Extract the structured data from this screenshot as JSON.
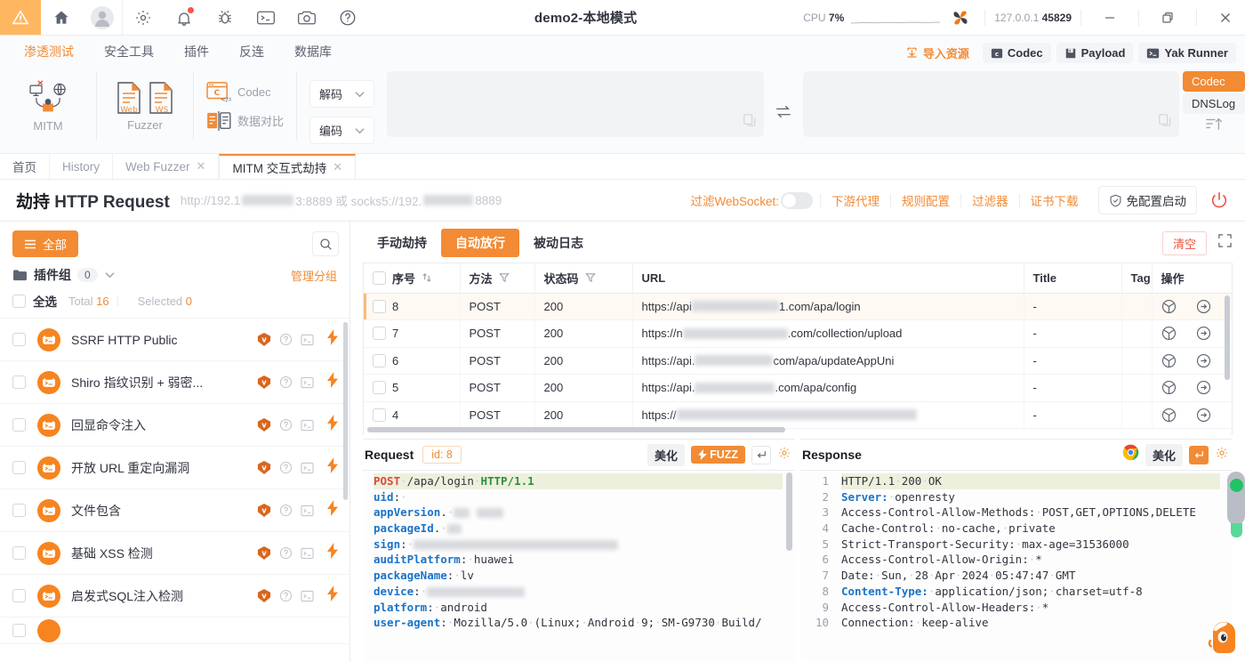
{
  "titlebar": {
    "icons": [
      {
        "name": "warning-triangle-icon",
        "label": "warning"
      },
      {
        "name": "home-icon",
        "label": "home"
      },
      {
        "name": "user-avatar-icon",
        "label": "account"
      },
      {
        "name": "gear-icon",
        "label": "settings"
      },
      {
        "name": "bell-icon",
        "label": "notifications"
      },
      {
        "name": "bug-icon",
        "label": "bug"
      },
      {
        "name": "terminal-icon",
        "label": "terminal"
      },
      {
        "name": "camera-icon",
        "label": "screenshot"
      },
      {
        "name": "help-circle-icon",
        "label": "help"
      }
    ],
    "title": "demo2-本地模式",
    "cpu_label": "CPU",
    "cpu_value": "7%",
    "address_host": "127.0.0.1",
    "address_port": "45829",
    "minimize": "—",
    "maximize": "❐",
    "close": "✕"
  },
  "ribbon": {
    "tabs": [
      {
        "label": "渗透测试",
        "active": true
      },
      {
        "label": "安全工具",
        "active": false
      },
      {
        "label": "插件",
        "active": false
      },
      {
        "label": "反连",
        "active": false
      },
      {
        "label": "数据库",
        "active": false
      }
    ],
    "right_actions": [
      {
        "label": "导入资源",
        "icon": "import-icon",
        "style": "import"
      },
      {
        "label": "Codec",
        "icon": "codec-icon",
        "style": "plain"
      },
      {
        "label": "Payload",
        "icon": "payload-icon",
        "style": "plain"
      },
      {
        "label": "Yak Runner",
        "icon": "yak-runner-icon",
        "style": "plain"
      }
    ],
    "big_buttons": [
      {
        "label": "MITM",
        "icon": "mitm-icon"
      },
      {
        "label": "Fuzzer",
        "icon": "fuzzer-icon"
      }
    ],
    "small_buttons": [
      {
        "label": "Codec",
        "icon": "codec-small-icon"
      },
      {
        "label": "数据对比",
        "icon": "data-compare-icon"
      }
    ],
    "selects": [
      {
        "label": "解码"
      },
      {
        "label": "编码"
      }
    ],
    "codec_stack": [
      {
        "label": "Codec",
        "selected": true
      },
      {
        "label": "DNSLog",
        "selected": false
      }
    ],
    "input_left_value": "",
    "input_right_value": ""
  },
  "page_tabs": [
    {
      "label": "首页",
      "closable": false,
      "active": false
    },
    {
      "label": "History",
      "closable": false,
      "active": false
    },
    {
      "label": "Web Fuzzer",
      "closable": true,
      "active": false
    },
    {
      "label": "MITM 交互式劫持",
      "closable": true,
      "active": true
    }
  ],
  "page_header": {
    "title_cn": "劫持",
    "title_en": "HTTP Request",
    "subtitle_prefix": "http://192.1",
    "subtitle_mid": "3:8889 或 socks5://192.",
    "subtitle_suffix": "8889",
    "filter_ws_label": "过滤WebSocket:",
    "links": [
      "下游代理",
      "规则配置",
      "过滤器",
      "证书下载"
    ],
    "free_config_button": "免配置启动",
    "power_icon": "power-icon"
  },
  "sidebar": {
    "all_button": "全部",
    "search_icon": "search-icon",
    "group_label": "插件组",
    "group_count": "0",
    "manage_group": "管理分组",
    "select_all": "全选",
    "total_label": "Total",
    "total_value": "16",
    "selected_label": "Selected",
    "selected_value": "0",
    "plugins": [
      {
        "name": "SSRF HTTP Public"
      },
      {
        "name": "Shiro 指纹识别 + 弱密..."
      },
      {
        "name": "回显命令注入"
      },
      {
        "name": "开放 URL 重定向漏洞"
      },
      {
        "name": "文件包含"
      },
      {
        "name": "基础 XSS 检测"
      },
      {
        "name": "启发式SQL注入检测"
      }
    ]
  },
  "main": {
    "tabs": [
      {
        "label": "手动劫持",
        "active": false
      },
      {
        "label": "自动放行",
        "active": true
      },
      {
        "label": "被动日志",
        "active": false
      }
    ],
    "clear_button": "清空",
    "expand_icon": "expand-icon",
    "table": {
      "columns": [
        "序号",
        "方法",
        "状态码",
        "URL",
        "Title",
        "Tag",
        "操作"
      ],
      "rows": [
        {
          "id": "8",
          "method": "POST",
          "status": "200",
          "url_prefix": "https://api",
          "url_suffix": "1.com/apa/login",
          "title": "-",
          "tag": "",
          "selected": true
        },
        {
          "id": "7",
          "method": "POST",
          "status": "200",
          "url_prefix": "https://n",
          "url_suffix": ".com/collection/upload",
          "title": "-",
          "tag": "",
          "selected": false
        },
        {
          "id": "6",
          "method": "POST",
          "status": "200",
          "url_prefix": "https://api.",
          "url_suffix": "com/apa/updateAppUni",
          "title": "-",
          "tag": "",
          "selected": false
        },
        {
          "id": "5",
          "method": "POST",
          "status": "200",
          "url_prefix": "https://api.",
          "url_suffix": ".com/apa/config",
          "title": "-",
          "tag": "",
          "selected": false
        },
        {
          "id": "4",
          "method": "POST",
          "status": "200",
          "url_prefix": "https://",
          "url_suffix": "",
          "title": "-",
          "tag": "",
          "selected": false
        }
      ]
    },
    "request_panel": {
      "title": "Request",
      "id_label": "id:",
      "id_value": "8",
      "beautify_label": "美化",
      "fuzz_label": "FUZZ",
      "lines": [
        {
          "tokens": [
            {
              "t": "POST",
              "c": "meth"
            },
            {
              "t": "·",
              "c": "dot"
            },
            {
              "t": "/apa/login",
              "c": ""
            },
            {
              "t": "·",
              "c": "dot"
            },
            {
              "t": "HTTP/1.1",
              "c": "ver"
            }
          ],
          "highlight": true
        },
        {
          "tokens": [
            {
              "t": "uid",
              "c": "k"
            },
            {
              "t": ":·",
              "c": ""
            }
          ],
          "highlight": false
        },
        {
          "tokens": [
            {
              "t": "appVersion",
              "c": "k"
            },
            {
              "t": ":·",
              "c": ""
            },
            {
              "t": "[redacted]",
              "c": "blur"
            }
          ],
          "highlight": false
        },
        {
          "tokens": [
            {
              "t": "packageId",
              "c": "k"
            },
            {
              "t": ":·",
              "c": ""
            },
            {
              "t": "[redacted]",
              "c": "blur"
            }
          ],
          "highlight": false
        },
        {
          "tokens": [
            {
              "t": "sign",
              "c": "k"
            },
            {
              "t": ":·",
              "c": ""
            },
            {
              "t": "[redacted]",
              "c": "blur"
            }
          ],
          "highlight": false
        },
        {
          "tokens": [
            {
              "t": "auditPlatform",
              "c": "k"
            },
            {
              "t": ":·huawei",
              "c": ""
            }
          ],
          "highlight": false
        },
        {
          "tokens": [
            {
              "t": "packageName",
              "c": "k"
            },
            {
              "t": ":·lv",
              "c": ""
            }
          ],
          "highlight": false
        },
        {
          "tokens": [
            {
              "t": "device",
              "c": "k"
            },
            {
              "t": ":·",
              "c": ""
            },
            {
              "t": "[redacted]",
              "c": "blur"
            }
          ],
          "highlight": false
        },
        {
          "tokens": [
            {
              "t": "platform",
              "c": "k"
            },
            {
              "t": ":·android",
              "c": ""
            }
          ],
          "highlight": false
        },
        {
          "tokens": [
            {
              "t": "user-agent",
              "c": "k"
            },
            {
              "t": ":·Mozilla/5.0·(Linux;·Android·9;·SM-G9730·Build/",
              "c": ""
            }
          ],
          "highlight": false
        }
      ]
    },
    "response_panel": {
      "title": "Response",
      "chrome_icon": "chrome-icon",
      "beautify_label": "美化",
      "lines": [
        {
          "no": "1",
          "tokens": [
            {
              "t": "HTTP/1.1·200·OK",
              "c": ""
            }
          ],
          "highlight": true
        },
        {
          "no": "2",
          "tokens": [
            {
              "t": "Server:",
              "c": "k"
            },
            {
              "t": "·openresty",
              "c": ""
            }
          ],
          "highlight": false
        },
        {
          "no": "3",
          "tokens": [
            {
              "t": "Access-Control-Allow-Methods:·POST,GET,OPTIONS,DELETE",
              "c": ""
            }
          ],
          "highlight": false
        },
        {
          "no": "4",
          "tokens": [
            {
              "t": "Cache-Control:·no-cache,·private",
              "c": ""
            }
          ],
          "highlight": false
        },
        {
          "no": "5",
          "tokens": [
            {
              "t": "Strict-Transport-Security:·max-age=31536000",
              "c": ""
            }
          ],
          "highlight": false
        },
        {
          "no": "6",
          "tokens": [
            {
              "t": "Access-Control-Allow-Origin:·*",
              "c": ""
            }
          ],
          "highlight": false
        },
        {
          "no": "7",
          "tokens": [
            {
              "t": "Date:·Sun,·28·Apr·2024·05:47:47·GMT",
              "c": ""
            }
          ],
          "highlight": false
        },
        {
          "no": "8",
          "tokens": [
            {
              "t": "Content-Type:",
              "c": "k"
            },
            {
              "t": "·application/json;·charset=utf-8",
              "c": ""
            }
          ],
          "highlight": false
        },
        {
          "no": "9",
          "tokens": [
            {
              "t": "Access-Control-Allow-Headers:·*",
              "c": ""
            }
          ],
          "highlight": false
        },
        {
          "no": "10",
          "tokens": [
            {
              "t": "Connection:·keep-alive",
              "c": ""
            }
          ],
          "highlight": false
        }
      ]
    }
  },
  "colors": {
    "accent": "#f28b34",
    "status_ok": "#3dbd7d",
    "danger": "#e8553e",
    "text": "#31343f",
    "muted": "#9ba0ab"
  }
}
